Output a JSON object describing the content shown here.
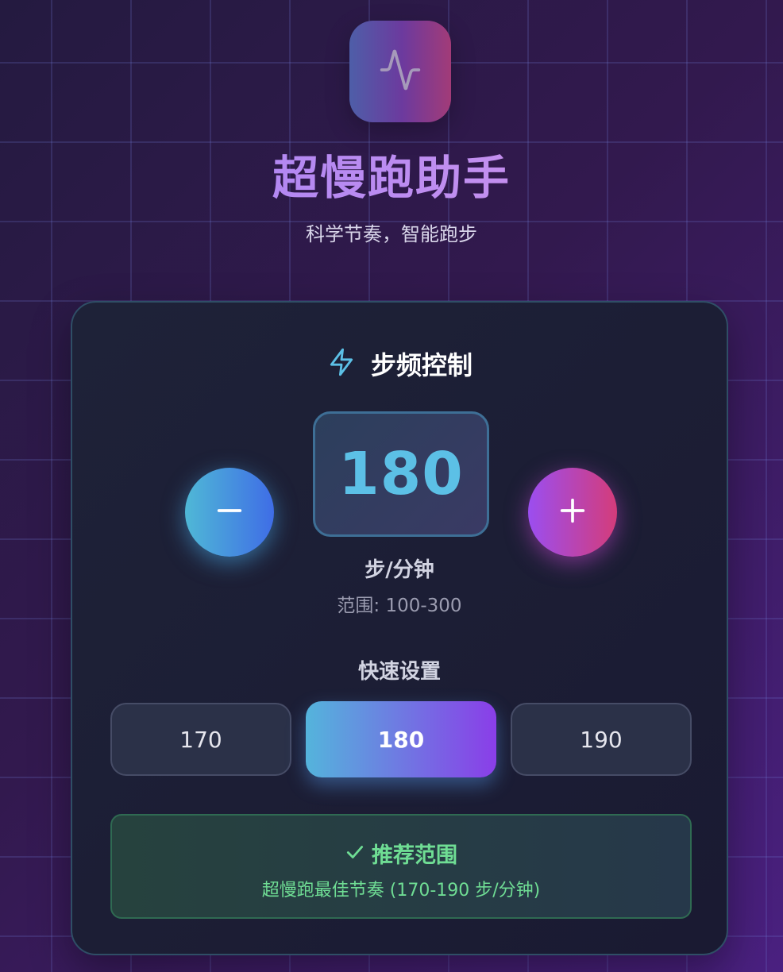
{
  "app": {
    "icon": "activity-pulse-icon",
    "title": "超慢跑助手",
    "subtitle": "科学节奏，智能跑步"
  },
  "cadence_card": {
    "header_icon": "lightning-icon",
    "title": "步频控制",
    "decrease_icon": "minus-icon",
    "increase_icon": "plus-icon",
    "value": "180",
    "unit": "步/分钟",
    "range_text": "范围: 100-300"
  },
  "quick_settings": {
    "title": "快速设置",
    "presets": [
      {
        "label": "170",
        "active": false
      },
      {
        "label": "180",
        "active": true
      },
      {
        "label": "190",
        "active": false
      }
    ]
  },
  "recommendation": {
    "icon": "checkmark-icon",
    "title": "推荐范围",
    "description": "超慢跑最佳节奏 (170-190 步/分钟)"
  },
  "colors": {
    "accent_cyan": "#5cc0e6",
    "accent_purple": "#8a3ee8",
    "accent_pink": "#d43c7a",
    "success_green": "#6fdd94"
  }
}
